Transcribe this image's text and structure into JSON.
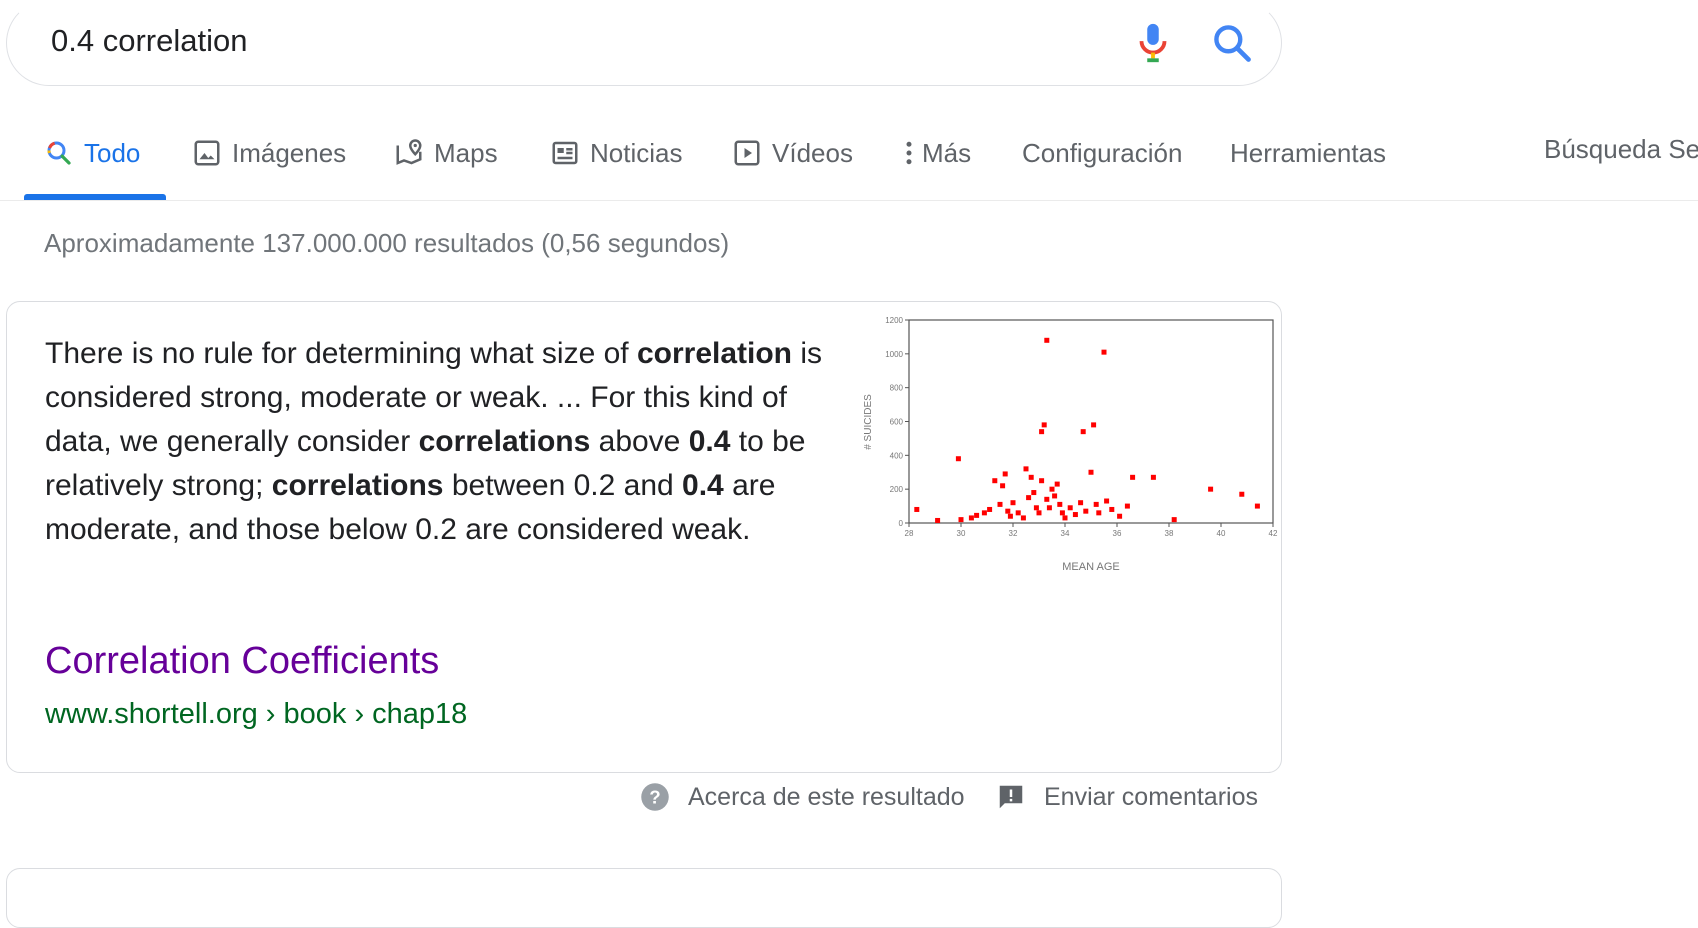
{
  "search": {
    "query": "0.4 correlation"
  },
  "tabs": [
    {
      "label": "Todo",
      "icon": "search-icon",
      "active": true
    },
    {
      "label": "Imágenes",
      "icon": "image-icon",
      "active": false
    },
    {
      "label": "Maps",
      "icon": "map-pin-icon",
      "active": false
    },
    {
      "label": "Noticias",
      "icon": "news-icon",
      "active": false
    },
    {
      "label": "Vídeos",
      "icon": "play-icon",
      "active": false
    },
    {
      "label": "Más",
      "icon": "more-vert-icon",
      "active": false
    },
    {
      "label": "Configuración",
      "active": false
    },
    {
      "label": "Herramientas",
      "active": false
    }
  ],
  "side_label": "Búsqueda Se",
  "result_stats": "Aproximadamente 137.000.000 resultados (0,56 segundos)",
  "snippet": {
    "segments": [
      {
        "text": "There is no rule for determining what size of ",
        "bold": false
      },
      {
        "text": "correlation",
        "bold": true
      },
      {
        "text": " is considered strong, moderate or weak. ... For this kind of data, we generally consider ",
        "bold": false
      },
      {
        "text": "correlations",
        "bold": true
      },
      {
        "text": " above ",
        "bold": false
      },
      {
        "text": "0.4",
        "bold": true
      },
      {
        "text": " to be relatively strong; ",
        "bold": false
      },
      {
        "text": "correlations",
        "bold": true
      },
      {
        "text": " between 0.2 and ",
        "bold": false
      },
      {
        "text": "0.4",
        "bold": true
      },
      {
        "text": " are moderate, and those below 0.2 are considered weak.",
        "bold": false
      }
    ],
    "title": "Correlation Coefficients",
    "url": "www.shortell.org › book › chap18"
  },
  "about": {
    "about_label": "Acerca de este resultado",
    "feedback_label": "Enviar comentarios"
  },
  "colors": {
    "accent": "#1a73e8",
    "visited_link": "#660099",
    "url_green": "#006621",
    "point_red": "#ff0000"
  },
  "chart_data": {
    "type": "scatter",
    "xlabel": "MEAN AGE",
    "ylabel": "# SUICIDES",
    "xlim": [
      28,
      42
    ],
    "ylim": [
      0,
      1200
    ],
    "xticks": [
      28,
      30,
      32,
      34,
      36,
      38,
      40,
      42
    ],
    "yticks": [
      0,
      200,
      400,
      600,
      800,
      1000,
      1200
    ],
    "series": [
      {
        "points": [
          [
            28.3,
            80
          ],
          [
            29.1,
            15
          ],
          [
            29.9,
            380
          ],
          [
            30.0,
            20
          ],
          [
            30.4,
            30
          ],
          [
            30.6,
            45
          ],
          [
            30.9,
            60
          ],
          [
            31.1,
            80
          ],
          [
            31.3,
            250
          ],
          [
            31.5,
            110
          ],
          [
            31.6,
            220
          ],
          [
            31.7,
            290
          ],
          [
            31.8,
            70
          ],
          [
            31.9,
            40
          ],
          [
            32.0,
            120
          ],
          [
            32.2,
            60
          ],
          [
            32.4,
            30
          ],
          [
            32.5,
            320
          ],
          [
            32.6,
            150
          ],
          [
            32.7,
            270
          ],
          [
            32.8,
            180
          ],
          [
            32.9,
            90
          ],
          [
            33.0,
            60
          ],
          [
            33.1,
            250
          ],
          [
            33.1,
            540
          ],
          [
            33.2,
            580
          ],
          [
            33.3,
            1080
          ],
          [
            33.3,
            140
          ],
          [
            33.4,
            90
          ],
          [
            33.5,
            200
          ],
          [
            33.6,
            160
          ],
          [
            33.7,
            230
          ],
          [
            33.8,
            110
          ],
          [
            33.9,
            60
          ],
          [
            34.0,
            30
          ],
          [
            34.2,
            90
          ],
          [
            34.4,
            50
          ],
          [
            34.6,
            120
          ],
          [
            34.7,
            540
          ],
          [
            34.8,
            70
          ],
          [
            35.0,
            300
          ],
          [
            35.1,
            580
          ],
          [
            35.2,
            110
          ],
          [
            35.3,
            60
          ],
          [
            35.5,
            1010
          ],
          [
            35.6,
            130
          ],
          [
            35.8,
            80
          ],
          [
            36.1,
            40
          ],
          [
            36.4,
            100
          ],
          [
            36.6,
            270
          ],
          [
            37.4,
            270
          ],
          [
            38.2,
            20
          ],
          [
            39.6,
            200
          ],
          [
            40.8,
            170
          ],
          [
            41.4,
            100
          ]
        ]
      }
    ]
  }
}
